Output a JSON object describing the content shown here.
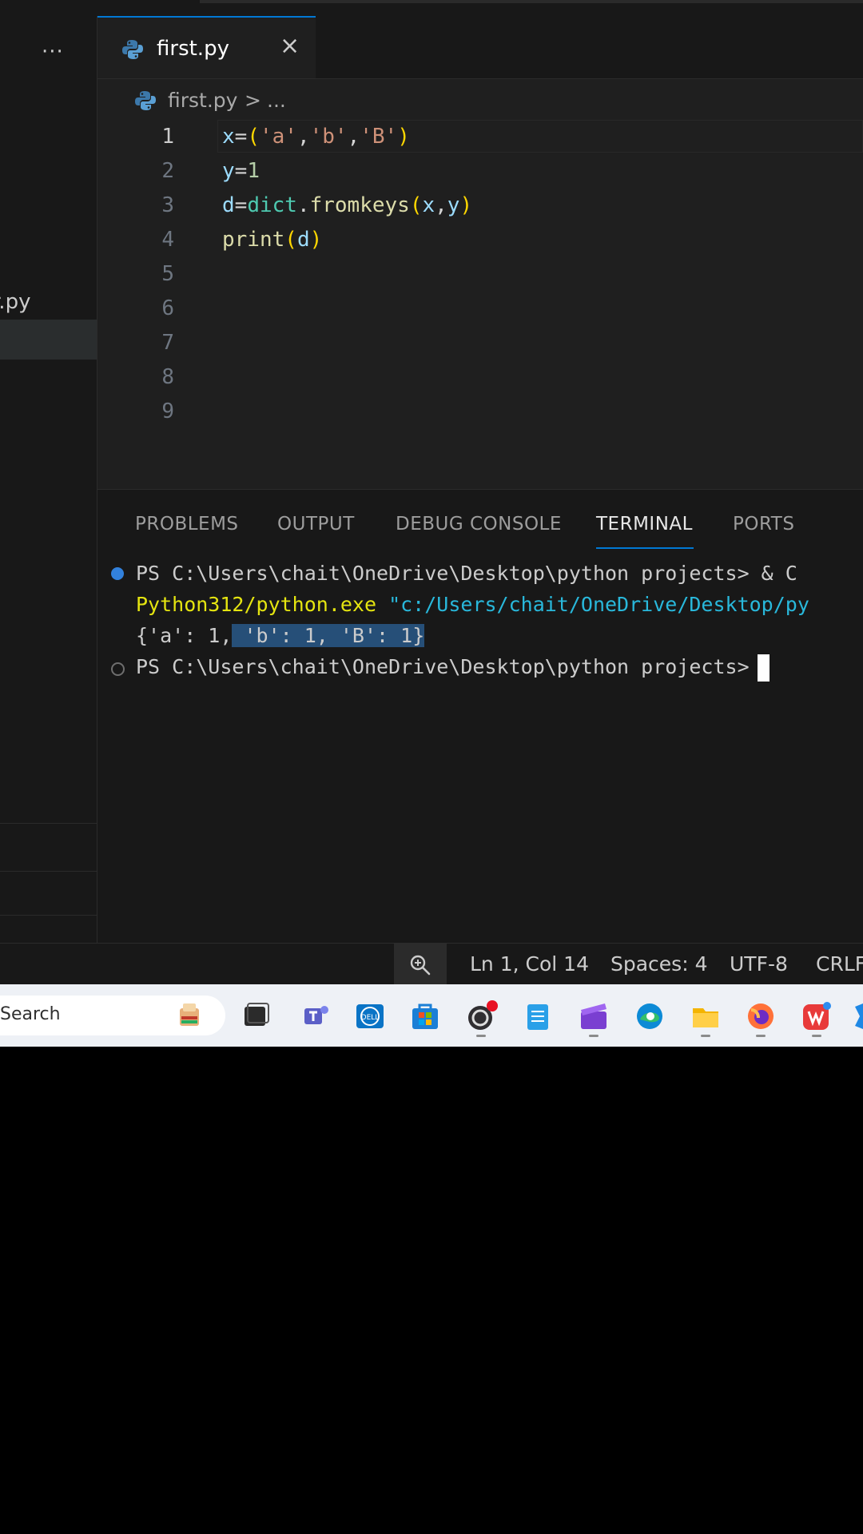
{
  "editor_tab": {
    "filename": "first.py",
    "close_glyph": "×"
  },
  "sidebar": {
    "more_glyph": "···",
    "file_label": "r.py"
  },
  "breadcrumb": {
    "file": "first.py",
    "separator": ">",
    "rest": "..."
  },
  "code_lines": [
    {
      "n": "1",
      "text": "x=('a','b','B')"
    },
    {
      "n": "2",
      "text": "y=1"
    },
    {
      "n": "3",
      "text": "d=dict.fromkeys(x,y)"
    },
    {
      "n": "4",
      "text": "print(d)"
    },
    {
      "n": "5",
      "text": ""
    },
    {
      "n": "6",
      "text": ""
    },
    {
      "n": "7",
      "text": ""
    },
    {
      "n": "8",
      "text": ""
    },
    {
      "n": "9",
      "text": ""
    }
  ],
  "panel_tabs": [
    {
      "label": "PROBLEMS"
    },
    {
      "label": "OUTPUT"
    },
    {
      "label": "DEBUG CONSOLE"
    },
    {
      "label": "TERMINAL",
      "active": true
    },
    {
      "label": "PORTS"
    }
  ],
  "terminal": {
    "line1_prompt": "PS C:\\Users\\chait\\OneDrive\\Desktop\\python projects>",
    "line1_cmd": " & C",
    "line2_exe": "Python312/python.exe",
    "line2_path": " \"c:/Users/chait/OneDrive/Desktop/py",
    "output_plain": "{'a': 1,",
    "output_selected": " 'b': 1, 'B': 1}",
    "line4_prompt": "PS C:\\Users\\chait\\OneDrive\\Desktop\\python projects>"
  },
  "status_bar": {
    "position": "Ln 1, Col 14",
    "spaces": "Spaces: 4",
    "encoding": "UTF-8",
    "eol": "CRLF"
  },
  "taskbar": {
    "search_label": "Search"
  },
  "colors": {
    "accent": "#0078d4",
    "editor_bg": "#1f1f1f",
    "panel_bg": "#181818",
    "taskbar_bg": "#eef1f6"
  }
}
